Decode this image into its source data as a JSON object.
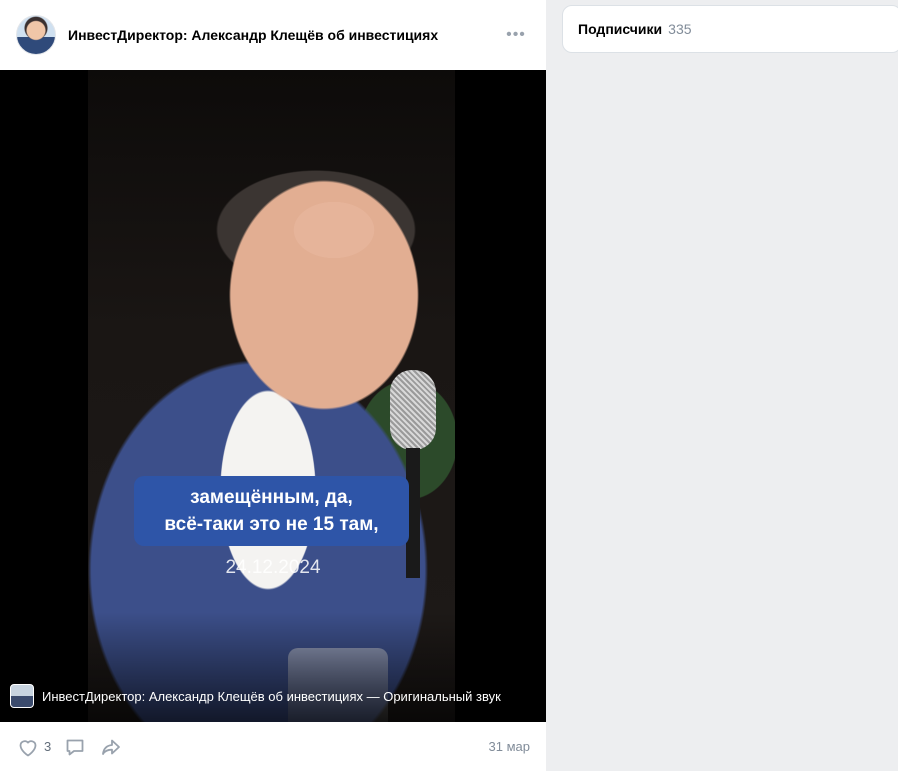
{
  "post": {
    "author": "ИнвестДиректор: Александр Клещёв об инвестициях",
    "more_icon": "more-horizontal-icon",
    "video": {
      "subtitle_line1": "замещённым, да,",
      "subtitle_line2": "всё-таки это не 15 там,",
      "date_overlay": "24.12.2024",
      "audio_text": "ИнвестДиректор: Александр Клещёв об инвестициях — Оригинальный звук"
    },
    "actions": {
      "like_icon": "heart-icon",
      "like_count": "3",
      "comment_icon": "comment-icon",
      "share_icon": "share-icon",
      "date": "31 мар"
    }
  },
  "sidebar": {
    "followers_label": "Подписчики",
    "followers_count": "335"
  },
  "colors": {
    "background": "#edeef0",
    "subtitle_bg": "#2e55a8",
    "icon_gray": "#99a2ad",
    "secondary_text": "#818c99"
  }
}
